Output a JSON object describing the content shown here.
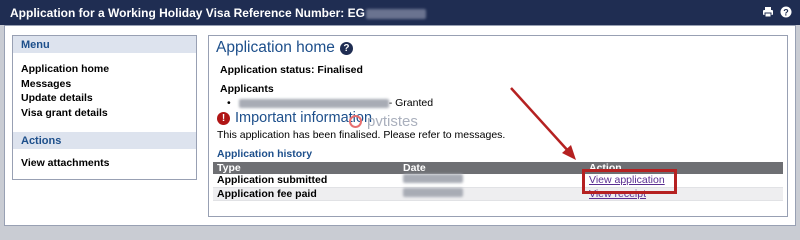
{
  "titlebar": {
    "title": "Application for a Working Holiday Visa Reference Number: EG",
    "icons": [
      "print-icon",
      "help-icon"
    ]
  },
  "sidebar": {
    "menu_heading": "Menu",
    "menu_items": [
      {
        "label": "Application home"
      },
      {
        "label": "Messages"
      },
      {
        "label": "Update details"
      },
      {
        "label": "Visa grant details"
      }
    ],
    "actions_heading": "Actions",
    "action_items": [
      {
        "label": "View attachments"
      }
    ]
  },
  "main": {
    "title": "Application home",
    "status_text": "Application status: Finalised",
    "applicants_heading": "Applicants",
    "applicant_suffix": " - Granted",
    "important_heading": "Important information",
    "watermark": "pvtistes",
    "finalised_text": "This application has been finalised. Please refer to messages.",
    "history_heading": "Application history",
    "history_columns": [
      "Type",
      "Date",
      "Action"
    ],
    "history_rows": [
      {
        "type": "Application submitted",
        "action": "View application"
      },
      {
        "type": "Application fee paid",
        "action": "View receipt"
      }
    ]
  },
  "colors": {
    "titlebar_bg": "#1f2d52",
    "heading_blue": "#1d4f8b",
    "table_header_bg": "#6e6f73",
    "annotation_red": "#b52121",
    "link_purple": "#5a2d91"
  }
}
